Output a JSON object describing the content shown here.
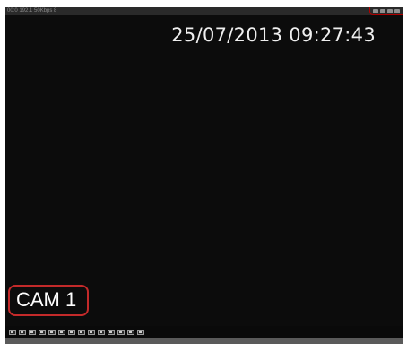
{
  "topbar": {
    "info_text": "00:0 192.1 50Kbps 8",
    "icons": [
      "record-icon",
      "audio-icon",
      "network-icon",
      "status-icon"
    ]
  },
  "overlay": {
    "timestamp": "25/07/2013  09:27:43",
    "camera_label": "CAM 1"
  },
  "toolbar": {
    "buttons": [
      "single-view-icon",
      "quad-view-icon",
      "nine-view-icon",
      "sixteen-view-icon",
      "layout-a-icon",
      "layout-b-icon",
      "layout-c-icon",
      "layout-d-icon",
      "layout-e-icon",
      "layout-f-icon",
      "layout-g-icon",
      "layout-h-icon",
      "layout-i-icon",
      "layout-j-icon"
    ]
  },
  "colors": {
    "video_bg": "#0c0c0c",
    "highlight": "#c42a2a",
    "text": "#ffffff"
  }
}
